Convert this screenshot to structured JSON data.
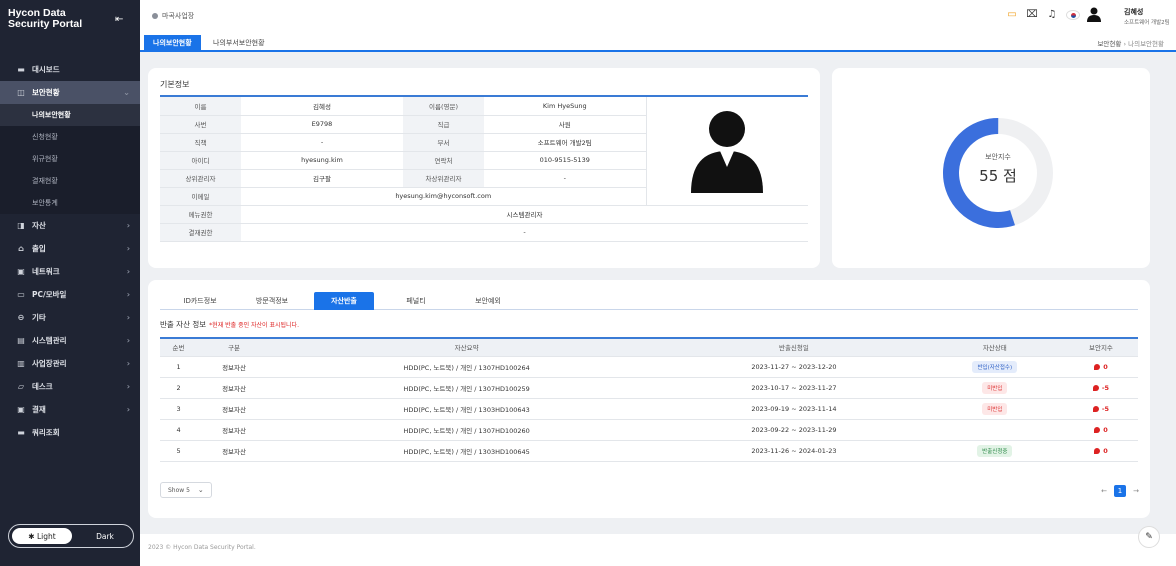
{
  "brand": {
    "title": "Hycon Data Security Portal",
    "toggle_icon": "menu-collapse-icon"
  },
  "sidebar": {
    "items": [
      {
        "label": "대시보드",
        "icon": "dashboard-icon"
      },
      {
        "label": "보안현황",
        "icon": "shield-icon",
        "active": true,
        "children": [
          {
            "label": "나의보안현황",
            "active": true
          },
          {
            "label": "신청현황"
          },
          {
            "label": "위규현황"
          },
          {
            "label": "결재현황"
          },
          {
            "label": "보안통계"
          }
        ]
      },
      {
        "label": "자산",
        "icon": "asset-icon"
      },
      {
        "label": "출입",
        "icon": "door-icon"
      },
      {
        "label": "네트워크",
        "icon": "network-icon"
      },
      {
        "label": "PC/모바일",
        "icon": "pc-icon"
      },
      {
        "label": "기타",
        "icon": "etc-icon"
      },
      {
        "label": "시스템관리",
        "icon": "system-icon"
      },
      {
        "label": "사업장관리",
        "icon": "building-icon"
      },
      {
        "label": "데스크",
        "icon": "desk-icon"
      },
      {
        "label": "결재",
        "icon": "approval-icon"
      },
      {
        "label": "쿼리조회",
        "icon": "query-icon"
      }
    ],
    "theme": {
      "light": "Light",
      "dark": "Dark"
    }
  },
  "topbar": {
    "location": "마곡사업장",
    "user_name": "김혜성",
    "user_dept": "소프트웨어 개발2팀"
  },
  "page_tabs": [
    "나의보안현황",
    "나의부서보안현황"
  ],
  "breadcrumb": {
    "parent": "보안현황",
    "current": "나의보안현황"
  },
  "basic_info": {
    "title": "기본정보",
    "rows": [
      {
        "l1": "이름",
        "v1": "김혜성",
        "l2": "이름(영문)",
        "v2": "Kim HyeSung"
      },
      {
        "l1": "사번",
        "v1": "E9798",
        "l2": "직급",
        "v2": "사원"
      },
      {
        "l1": "직책",
        "v1": "-",
        "l2": "부서",
        "v2": "소프트웨어 개발2팀"
      },
      {
        "l1": "아이디",
        "v1": "hyesung.kim",
        "l2": "연락처",
        "v2": "010-9515-5139"
      },
      {
        "l1": "상위관리자",
        "v1": "김구팔",
        "l2": "차상위관리자",
        "v2": "-"
      }
    ],
    "email_label": "이메일",
    "email": "hyesung.kim@hyconsoft.com",
    "menu_label": "메뉴권한",
    "menu": "시스템관리자",
    "approval_label": "결재권한",
    "approval": "-"
  },
  "security_index": {
    "label": "보안지수",
    "value": "55 점",
    "percent": 55,
    "color": "#3b6fdd",
    "track": "#eff0f2"
  },
  "detail_tabs": [
    "ID카드정보",
    "방문객정보",
    "자산반출",
    "페널티",
    "보안예외"
  ],
  "active_detail_tab": 2,
  "export_section": {
    "title": "반출 자산 정보",
    "note": "*현재 반출 중인 자산이 표시됩니다."
  },
  "table": {
    "headers": [
      "순번",
      "구분",
      "자산요약",
      "반출신청일",
      "자산상태",
      "보안지수"
    ],
    "rows": [
      {
        "no": "1",
        "type": "정보자산",
        "summary": "HDD(PC, 노트북) / 개인 / 1307HD100264",
        "period": "2023-11-27 ~ 2023-12-20",
        "status": "반입(자산접수)",
        "status_kind": "blue",
        "score": "0"
      },
      {
        "no": "2",
        "type": "정보자산",
        "summary": "HDD(PC, 노트북) / 개인 / 1307HD100259",
        "period": "2023-10-17 ~ 2023-11-27",
        "status": "미반입",
        "status_kind": "red",
        "score": "-5"
      },
      {
        "no": "3",
        "type": "정보자산",
        "summary": "HDD(PC, 노트북) / 개인 / 1303HD100643",
        "period": "2023-09-19 ~ 2023-11-14",
        "status": "미반입",
        "status_kind": "red",
        "score": "-5"
      },
      {
        "no": "4",
        "type": "정보자산",
        "summary": "HDD(PC, 노트북) / 개인 / 1307HD100260",
        "period": "2023-09-22 ~ 2023-11-29",
        "status": "",
        "status_kind": "",
        "score": "0"
      },
      {
        "no": "5",
        "type": "정보자산",
        "summary": "HDD(PC, 노트북) / 개인 / 1303HD100645",
        "period": "2023-11-26 ~ 2024-01-23",
        "status": "반출신청중",
        "status_kind": "green",
        "score": "0"
      }
    ]
  },
  "pagination": {
    "show": "Show 5",
    "current": "1"
  },
  "footer": "2023 © Hycon Data Security Portal."
}
